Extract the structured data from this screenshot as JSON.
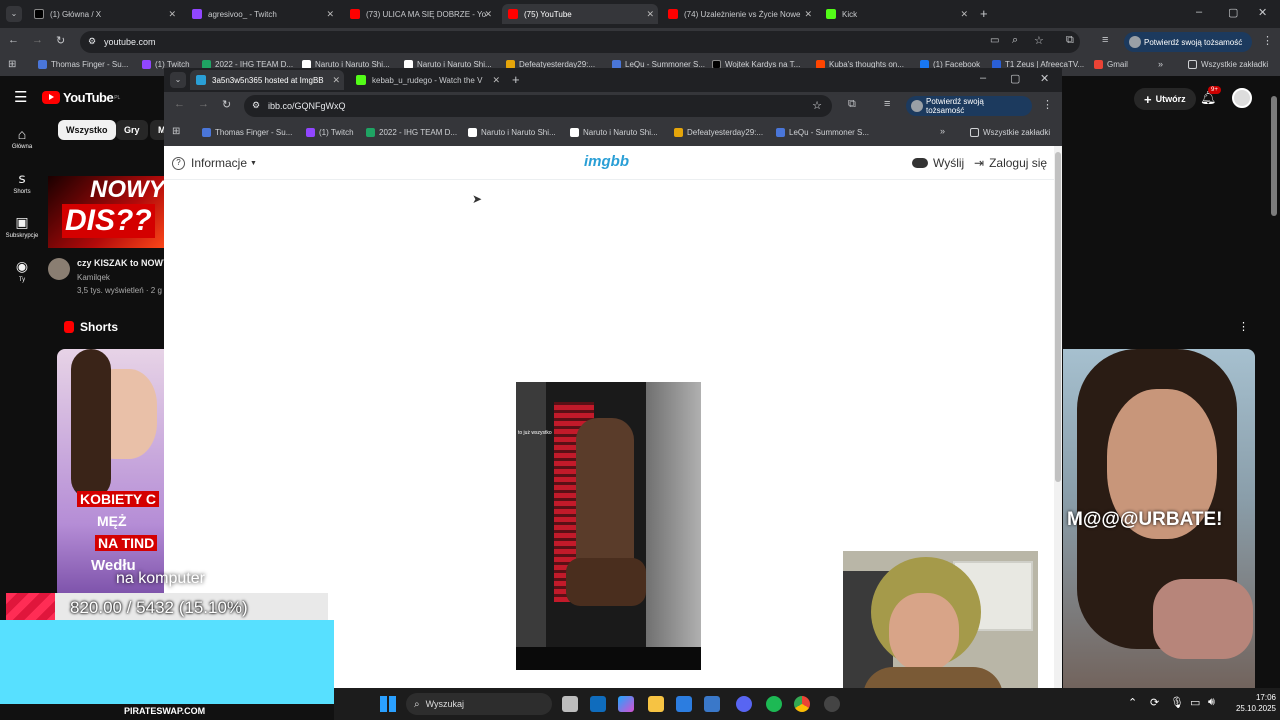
{
  "outer_browser": {
    "tabs": [
      {
        "label": "(1) Główna / X",
        "color": "#000000"
      },
      {
        "label": "agresivoo_ - Twitch",
        "color": "#9146ff"
      },
      {
        "label": "(73) ULICA MA SIĘ DOBRZE - Yo",
        "color": "#ff0000"
      },
      {
        "label": "(75) YouTube",
        "color": "#ff0000"
      },
      {
        "label": "(74) Uzależnienie vs Życie Nowe",
        "color": "#ff0000"
      },
      {
        "label": "Kick",
        "color": "#53fc18"
      }
    ],
    "url": "youtube.com",
    "verify_label": "Potwierdź swoją tożsamość",
    "bookmarks": [
      "Thomas Finger - Su...",
      "(1) Twitch",
      "2022 - IHG TEAM D...",
      "Naruto i Naruto Shi...",
      "Naruto i Naruto Shi...",
      "Defeatyesterday29:...",
      "LeQu - Summoner S...",
      "Wojtek Kardys na T...",
      "Kuba's thoughts on...",
      "(1) Facebook",
      "T1 Zeus | AfreecaTV...",
      "Gmail"
    ],
    "all_bookmarks_label": "Wszystkie zakładki"
  },
  "youtube": {
    "logo_text": "YouTube",
    "logo_region": "PL",
    "side": [
      {
        "icon": "home-icon",
        "label": "Główna"
      },
      {
        "icon": "shorts-icon",
        "label": "Shorts"
      },
      {
        "icon": "subscriptions-icon",
        "label": "Subskrypcje"
      },
      {
        "icon": "user-icon",
        "label": "Ty"
      }
    ],
    "chips": [
      "Wszystko",
      "Gry",
      "M"
    ],
    "create_label": "Utwórz",
    "notif_badge": "9+",
    "video": {
      "thumb_line1": "NOWY",
      "thumb_line2": "DIS??",
      "title": "czy KISZAK to NOWY",
      "channel": "Kamilqek",
      "meta": "3,5 tys. wyświetleń · 2 g"
    },
    "shorts_label": "Shorts",
    "short_left_lines": [
      "KOBIETY C",
      "MĘŻ",
      "NA TIND",
      "Wedłu"
    ],
    "short_right_caption": "M@@@URBATE!"
  },
  "inner_browser": {
    "tabs": [
      {
        "label": "3a5n3w5n365 hosted at ImgBB",
        "color": "#2a9fd6"
      },
      {
        "label": "kebab_u_rudego - Watch the V",
        "color": "#53fc18"
      }
    ],
    "url": "ibb.co/GQNFgWxQ",
    "verify_label": "Potwierdź swoją tożsamość",
    "bookmarks": [
      "Thomas Finger - Su...",
      "(1) Twitch",
      "2022 - IHG TEAM D...",
      "Naruto i Naruto Shi...",
      "Naruto i Naruto Shi...",
      "Defeatyesterday29:...",
      "LeQu - Summoner S..."
    ],
    "all_bookmarks_label": "Wszystkie zakładki"
  },
  "imgbb": {
    "info_label": "Informacje",
    "logo": "imgbb",
    "upload_label": "Wyślij",
    "login_label": "Zaloguj się",
    "image_caption": "to już wszystko"
  },
  "overlay": {
    "subtitle": "na komputer",
    "progress_text": "820.00 / 5432 (15.10%)",
    "progress_fraction": 0.151,
    "sponsor": "PIRATESWAP.COM"
  },
  "taskbar": {
    "search_placeholder": "Wyszukaj",
    "time": "17:06",
    "date": "25.10.2025"
  }
}
